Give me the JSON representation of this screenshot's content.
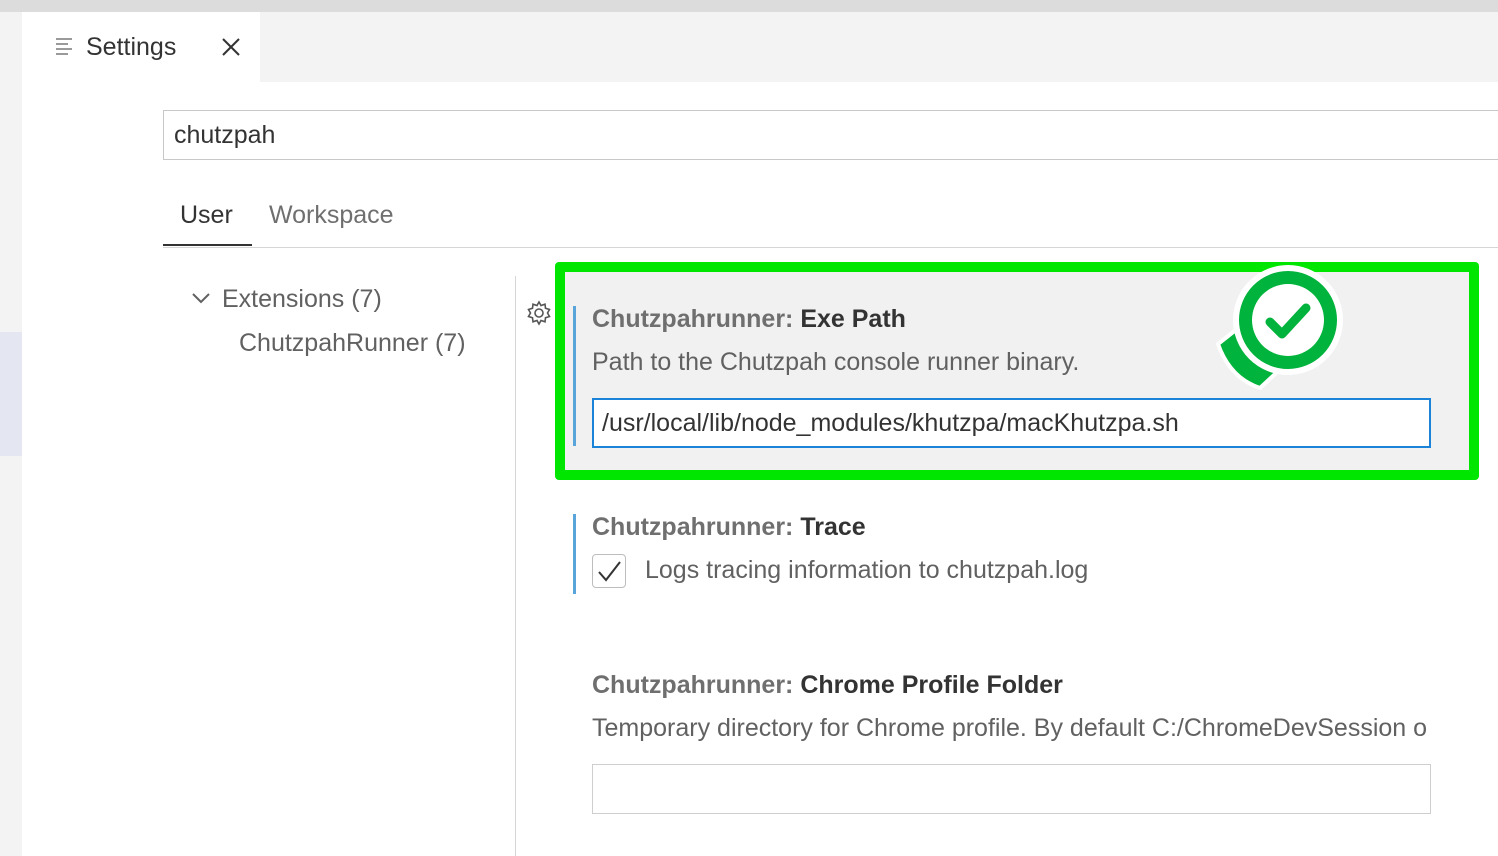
{
  "tab": {
    "title": "Settings",
    "icon": "settings-list-icon"
  },
  "search": {
    "value": "chutzpah"
  },
  "scope_tabs": {
    "user": "User",
    "workspace": "Workspace"
  },
  "tree": {
    "extensions": "Extensions (7)",
    "runner": "ChutzpahRunner (7)"
  },
  "settings": {
    "exe_path": {
      "category": "Chutzpahrunner: ",
      "name": "Exe Path",
      "description": "Path to the Chutzpah console runner binary.",
      "value": "/usr/local/lib/node_modules/khutzpa/macKhutzpa.sh"
    },
    "trace": {
      "category": "Chutzpahrunner: ",
      "name": "Trace",
      "checkbox_label": "Logs tracing information to chutzpah.log",
      "checked": true
    },
    "chrome_profile": {
      "category": "Chutzpahrunner: ",
      "name": "Chrome Profile Folder",
      "description": "Temporary directory for Chrome profile. By default C:/ChromeDevSession o",
      "value": ""
    }
  },
  "colors": {
    "highlight": "#00e600",
    "modified_bar": "#59a4d8",
    "focus_border": "#1c84d8",
    "badge": "#00b33c"
  }
}
